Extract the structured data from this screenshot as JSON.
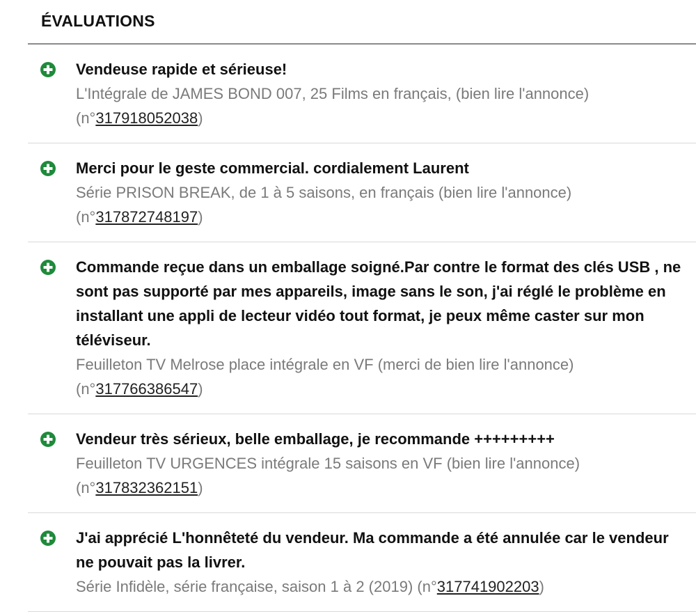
{
  "header": {
    "title": "ÉVALUATIONS"
  },
  "colors": {
    "positive_icon": "#1f8a3b",
    "divider": "#d9d9d9",
    "header_rule": "#8a8a8a"
  },
  "reviews": [
    {
      "rating_icon": "plus-circle-icon",
      "comment": "Vendeuse rapide et sérieuse!",
      "item_title": "L'Intégrale de JAMES BOND 007, 25 Films en français, (bien lire l'annonce)",
      "num_prefix": "(n°",
      "item_number": "317918052038",
      "num_suffix": ")"
    },
    {
      "rating_icon": "plus-circle-icon",
      "comment": "Merci pour le geste commercial. cordialement Laurent",
      "item_title": "Série PRISON BREAK, de 1 à 5 saisons, en français (bien lire l'annonce)",
      "num_prefix": "(n°",
      "item_number": "317872748197",
      "num_suffix": ")"
    },
    {
      "rating_icon": "plus-circle-icon",
      "comment": "Commande reçue dans un emballage soigné.Par contre le format des clés USB , ne sont pas supporté par mes appareils, image sans le son, j'ai réglé le problème en installant une appli de lecteur vidéo tout format, je peux même caster sur mon téléviseur.",
      "item_title": "Feuilleton TV Melrose place intégrale en VF (merci de bien lire l'annonce)",
      "num_prefix": "(n°",
      "item_number": "317766386547",
      "num_suffix": ")"
    },
    {
      "rating_icon": "plus-circle-icon",
      "comment": "Vendeur très sérieux, belle emballage, je recommande +++++++++",
      "item_title": "Feuilleton TV URGENCES intégrale 15 saisons en VF (bien lire l'annonce)",
      "num_prefix": "(n°",
      "item_number": "317832362151",
      "num_suffix": ")"
    },
    {
      "rating_icon": "plus-circle-icon",
      "comment": "J'ai apprécié L'honnêteté du vendeur. Ma commande a été annulée car le vendeur ne pouvait pas la livrer.",
      "item_title": "Série Infidèle, série française, saison 1 à 2 (2019)",
      "num_prefix": "(n°",
      "item_number": "317741902203",
      "num_suffix": ")"
    }
  ]
}
